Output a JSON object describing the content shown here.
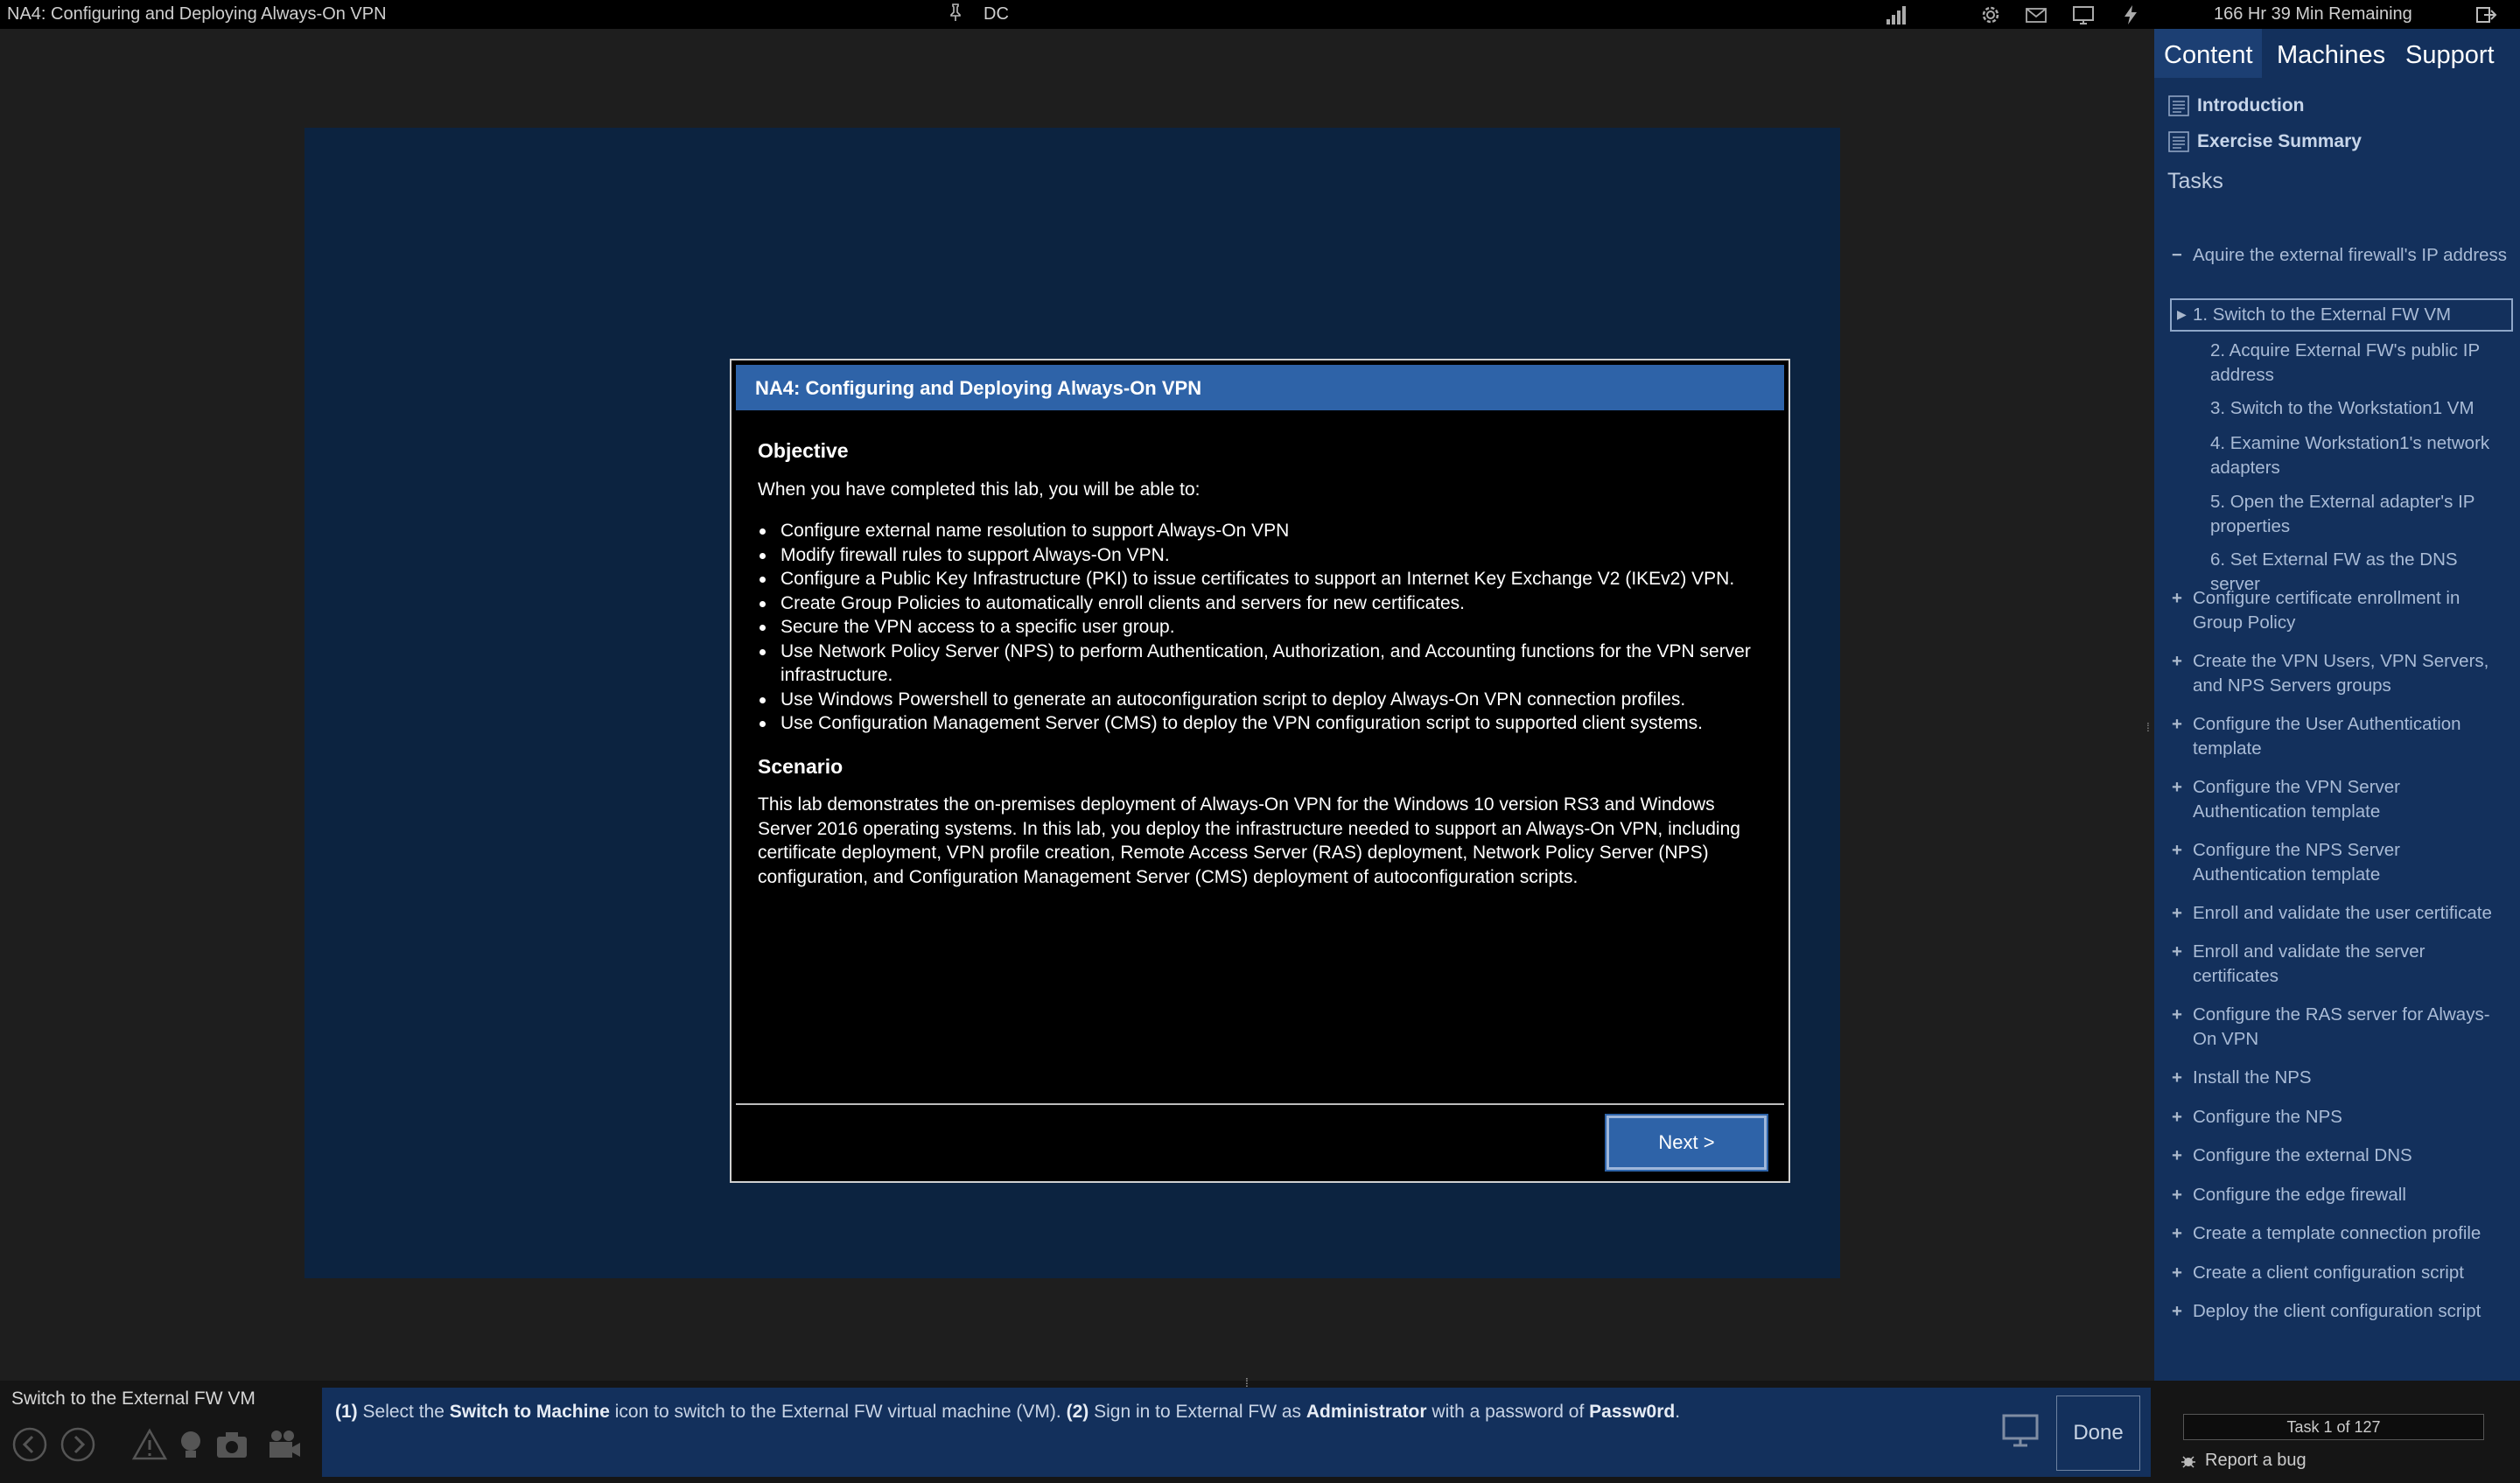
{
  "topbar": {
    "title": "NA4: Configuring and Deploying Always-On VPN",
    "vm_name": "DC",
    "time_remaining": "166 Hr 39 Min Remaining"
  },
  "dialog": {
    "title": "NA4: Configuring and Deploying Always-On VPN",
    "objective_heading": "Objective",
    "objective_intro": "When you have completed this lab, you will be able to:",
    "objectives": [
      "Configure external name resolution to support Always-On VPN",
      "Modify firewall rules to support Always-On VPN.",
      "Configure a Public Key Infrastructure (PKI) to issue certificates to support an Internet Key Exchange V2 (IKEv2) VPN.",
      "Create Group Policies to automatically enroll clients and servers for new certificates.",
      "Secure the VPN access to a specific user group.",
      "Use Network Policy Server (NPS) to perform Authentication, Authorization, and Accounting functions for the VPN server infrastructure.",
      "Use Windows Powershell to generate an autoconfiguration script to deploy Always-On VPN connection profiles.",
      "Use Configuration Management Server (CMS) to deploy the VPN configuration script to supported client systems."
    ],
    "scenario_heading": "Scenario",
    "scenario_text": "This lab demonstrates the on-premises deployment of Always-On VPN for the Windows 10 version RS3 and Windows Server 2016 operating systems. In this lab, you deploy the infrastructure needed to support an Always-On VPN, including certificate deployment, VPN profile creation, Remote Access Server (RAS) deployment, Network Policy Server (NPS) configuration, and Configuration Management Server (CMS) deployment of autoconfiguration scripts.",
    "next_label": "Next >"
  },
  "sidebar": {
    "tabs": [
      "Content",
      "Machines",
      "Support"
    ],
    "links": [
      "Introduction",
      "Exercise Summary"
    ],
    "tasks_label": "Tasks",
    "tasks": [
      {
        "sign": "−",
        "label": "Aquire the external firewall's IP address"
      },
      {
        "sign": "▶",
        "label": "1. Switch to the External FW VM",
        "sub": true,
        "selected": true
      },
      {
        "sign": "",
        "label": "2. Acquire External FW's public IP address",
        "sub": true
      },
      {
        "sign": "",
        "label": "3. Switch to the Workstation1 VM",
        "sub": true
      },
      {
        "sign": "",
        "label": "4. Examine Workstation1's network adapters",
        "sub": true
      },
      {
        "sign": "",
        "label": "5. Open the External adapter's IP properties",
        "sub": true
      },
      {
        "sign": "",
        "label": "6. Set External FW as the DNS server",
        "sub": true
      },
      {
        "sign": "+",
        "label": "Configure certificate enrollment in Group Policy"
      },
      {
        "sign": "+",
        "label": "Create the VPN Users, VPN Servers, and NPS Servers groups"
      },
      {
        "sign": "+",
        "label": "Configure the User Authentication template"
      },
      {
        "sign": "+",
        "label": "Configure the VPN Server Authentication template"
      },
      {
        "sign": "+",
        "label": "Configure the NPS Server Authentication template"
      },
      {
        "sign": "+",
        "label": "Enroll and validate the user certificate"
      },
      {
        "sign": "+",
        "label": "Enroll and validate the server certificates"
      },
      {
        "sign": "+",
        "label": "Configure the RAS server for Always-On VPN"
      },
      {
        "sign": "+",
        "label": "Install the NPS"
      },
      {
        "sign": "+",
        "label": "Configure the NPS"
      },
      {
        "sign": "+",
        "label": "Configure the external DNS"
      },
      {
        "sign": "+",
        "label": "Configure the edge firewall"
      },
      {
        "sign": "+",
        "label": "Create a template connection profile"
      },
      {
        "sign": "+",
        "label": "Create a client configuration script"
      },
      {
        "sign": "+",
        "label": "Deploy the client configuration script"
      }
    ]
  },
  "bottom": {
    "step_title": "Switch to the External FW VM",
    "instruction": {
      "p1_num": "(1)",
      "p1_a": " Select the ",
      "p1_b": "Switch to Machine",
      "p1_c": " icon to switch to the External FW virtual machine (VM). ",
      "p2_num": "(2)",
      "p2_a": " Sign in to External FW as ",
      "p2_b": "Administrator",
      "p2_c": " with a password of ",
      "p2_d": "Passw0rd",
      "p2_e": "."
    },
    "done_label": "Done",
    "task_count": "Task 1 of 127",
    "report_bug": "Report a bug"
  },
  "icons": {
    "topbar": [
      "pin-icon",
      "signal-icon",
      "settings-icon",
      "mail-icon",
      "monitor-icon",
      "power-icon",
      "exit-icon"
    ],
    "bottom": [
      "back-icon",
      "forward-icon",
      "warning-icon",
      "lightbulb-icon",
      "camera-icon",
      "video-icon",
      "switch-machine-icon",
      "bug-icon"
    ]
  }
}
